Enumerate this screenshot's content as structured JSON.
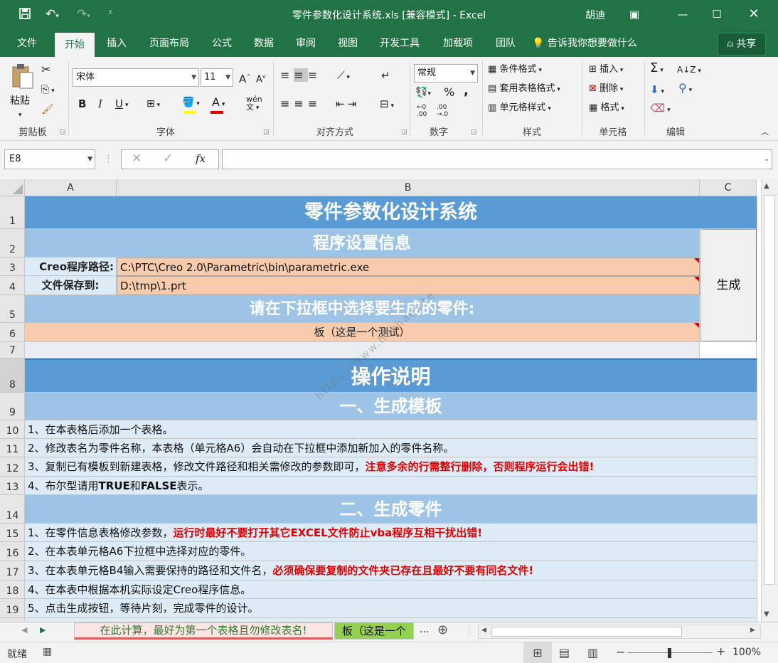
{
  "window": {
    "title": "零件参数化设计系统.xls  [兼容模式]  -  Excel",
    "user": "胡迪"
  },
  "tabs": [
    "文件",
    "开始",
    "插入",
    "页面布局",
    "公式",
    "数据",
    "审阅",
    "视图",
    "开发工具",
    "加载项",
    "团队"
  ],
  "tell_me": "告诉我你想要做什么",
  "share": "共享",
  "ribbon": {
    "clipboard": {
      "paste": "粘贴",
      "label": "剪贴板"
    },
    "font": {
      "name": "宋体",
      "size": "11",
      "label": "字体",
      "bold": "B",
      "italic": "I",
      "underline": "U"
    },
    "align": {
      "label": "对齐方式"
    },
    "number": {
      "format": "常规",
      "label": "数字",
      "percent": "%",
      "comma": ","
    },
    "styles": {
      "cond": "条件格式",
      "table": "套用表格格式",
      "cell": "单元格样式",
      "label": "样式"
    },
    "cells": {
      "insert": "插入",
      "delete": "删除",
      "format": "格式",
      "label": "单元格"
    },
    "edit": {
      "label": "编辑"
    }
  },
  "formula_bar": {
    "name_box": "E8",
    "fx": "fx",
    "value": ""
  },
  "columns": [
    "A",
    "B",
    "C"
  ],
  "rows": [
    "1",
    "2",
    "3",
    "4",
    "5",
    "6",
    "7",
    "8",
    "9",
    "10",
    "11",
    "12",
    "13",
    "14",
    "15",
    "16",
    "17",
    "18",
    "19"
  ],
  "sheet": {
    "r1": "零件参数化设计系统",
    "r2": "程序设置信息",
    "r3_label": "Creo程序路径:",
    "r3_value": "C:\\PTC\\Creo 2.0\\Parametric\\bin\\parametric.exe",
    "r4_label": "文件保存到:",
    "r4_value": "D:\\tmp\\1.prt",
    "r5": "请在下拉框中选择要生成的零件:",
    "r6": "板（这是一个测试）",
    "button": "生成",
    "r8": "操作说明",
    "r9": "一、生成模板",
    "r10": "1、在本表格后添加一个表格。",
    "r11": "2、修改表名为零件名称，本表格（单元格A6）会自动在下拉框中添加新加入的零件名称。",
    "r12_a": "3、复制已有模板到新建表格，修改文件路径和相关需修改的参数即可，",
    "r12_b": "注意多余的行需整行删除，否则程序运行会出错!",
    "r13_a": "4、布尔型请用",
    "r13_b": "TRUE",
    "r13_c": "和",
    "r13_d": "FALSE",
    "r13_e": "表示。",
    "r14": "二、生成零件",
    "r15_a": "1、在零件信息表格修改参数，",
    "r15_b": "运行时最好不要打开其它EXCEL文件防止vba程序互相干扰出错!",
    "r16": "2、在本表单元格A6下拉框中选择对应的零件。",
    "r17_a": "3、在本表单元格B4输入需要保持的路径和文件名，",
    "r17_b": "必须确保要复制的文件夹已存在且最好不要有同名文件!",
    "r18": "4、在本表中根据本机实际设定Creo程序信息。",
    "r19": "5、点击生成按钮，等待片刻，完成零件的设计。",
    "watermark": "https://www.huzhaosite"
  },
  "sheet_tabs": [
    "在此计算，最好为第一个表格且勿修改表名!",
    "板（这是一个",
    "..."
  ],
  "status": {
    "ready": "就绪",
    "zoom": "100%"
  },
  "colors": {
    "excel_green": "#217346",
    "header_blue": "#5b9bd5",
    "sub_blue": "#9dc3e6",
    "pale_blue": "#ddebf7",
    "orange": "#f8cbad",
    "warn_red": "#e00000"
  }
}
